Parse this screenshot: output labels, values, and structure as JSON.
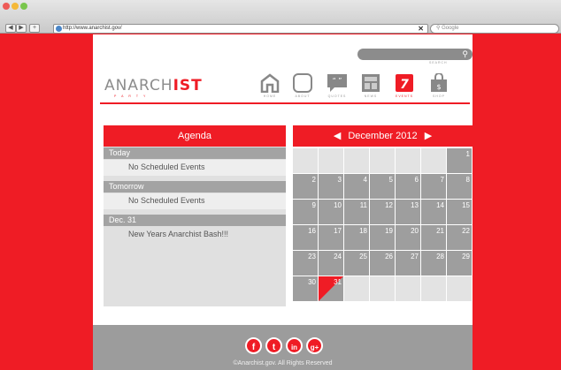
{
  "browser": {
    "url": "http://www.anarchist.gov/",
    "search_placeholder": "Google",
    "back_label": "◀",
    "forward_label": "▶",
    "add_label": "+",
    "clear_label": "✕",
    "traffic_colors": [
      "#ee5b57",
      "#f5b939",
      "#79c64c"
    ]
  },
  "site": {
    "logo_text_a": "ANARCH",
    "logo_text_b": "IST",
    "logo_tagline": "PARTY",
    "search_caption": "SEARCH",
    "accent": "#ef1c25",
    "nav": [
      {
        "label": "HOME",
        "icon": "home-icon"
      },
      {
        "label": "ABOUT",
        "icon": "about-icon"
      },
      {
        "label": "QUOTES",
        "icon": "quote-icon"
      },
      {
        "label": "NEWS",
        "icon": "news-icon"
      },
      {
        "label": "EVENTS",
        "icon": "calendar-icon",
        "icon_text": "7"
      },
      {
        "label": "SHOP",
        "icon": "shopping-bag-icon",
        "icon_text": "$"
      }
    ]
  },
  "agenda": {
    "title": "Agenda",
    "groups": [
      {
        "date": "Today",
        "events": [
          "No Scheduled Events"
        ]
      },
      {
        "date": "Tomorrow",
        "events": [
          "No Scheduled Events"
        ]
      },
      {
        "date": "Dec. 31",
        "events": [
          "New Years Anarchist Bash!!!"
        ]
      }
    ]
  },
  "calendar": {
    "month": "December 2012",
    "prev_label": "◀",
    "next_label": "▶",
    "leading_blanks": 6,
    "days_in_month": 31,
    "highlight_day": 31
  },
  "footer": {
    "social": [
      {
        "label": "f",
        "icon": "facebook-icon"
      },
      {
        "label": "t",
        "icon": "twitter-icon"
      },
      {
        "label": "in",
        "icon": "linkedin-icon"
      },
      {
        "label": "g+",
        "icon": "google-plus-icon"
      }
    ],
    "copyright": "©Anarchist.gov. All Rights Reserved"
  }
}
